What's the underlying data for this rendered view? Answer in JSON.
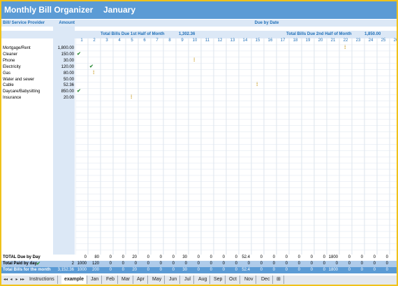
{
  "title": "Monthly Bill Organizer",
  "month": "January",
  "headers": {
    "provider": "Bill/ Service Provider",
    "amount": "Amount",
    "due": "Due by Date"
  },
  "totals": {
    "first_half_label": "Total Bills Due 1st Half of Month",
    "first_half_value": "1,302.36",
    "second_half_label": "Total Bills Due 2nd Half of Month",
    "second_half_value": "1,850.00"
  },
  "days": [
    "1",
    "2",
    "3",
    "4",
    "5",
    "6",
    "7",
    "8",
    "9",
    "10",
    "11",
    "12",
    "13",
    "14",
    "15",
    "16",
    "17",
    "18",
    "19",
    "20",
    "21",
    "22",
    "23",
    "24",
    "25",
    "26"
  ],
  "bills": [
    {
      "name": "Mortgage/Rent",
      "amount": "1,800.00"
    },
    {
      "name": "Cleaner",
      "amount": "150.00"
    },
    {
      "name": "Phone",
      "amount": "30.00"
    },
    {
      "name": "Electricity",
      "amount": "120.00"
    },
    {
      "name": "Gas",
      "amount": "80.00"
    },
    {
      "name": "Water and sewer",
      "amount": "50.00"
    },
    {
      "name": "Cable",
      "amount": "52.36"
    },
    {
      "name": "Daycare/Babysitting",
      "amount": "850.00"
    },
    {
      "name": "Insurance",
      "amount": "20.00"
    }
  ],
  "marks": [
    {
      "row": 0,
      "day": 22,
      "type": "pending"
    },
    {
      "row": 1,
      "day": 1,
      "type": "paid"
    },
    {
      "row": 2,
      "day": 10,
      "type": "pending"
    },
    {
      "row": 3,
      "day": 2,
      "type": "paid"
    },
    {
      "row": 4,
      "day": 2,
      "type": "pending"
    },
    {
      "row": 6,
      "day": 15,
      "type": "pending"
    },
    {
      "row": 7,
      "day": 1,
      "type": "paid"
    },
    {
      "row": 8,
      "day": 5,
      "type": "pending"
    }
  ],
  "footer": {
    "total_due_label": "TOTAL Due by Day",
    "total_paid_label": "Total Paid by day",
    "total_bills_label": "Total Bills for the month",
    "paid_main": "2",
    "bills_main": "3,152.36",
    "due_values": [
      "0",
      "80",
      "0",
      "0",
      "20",
      "0",
      "0",
      "0",
      "30",
      "0",
      "0",
      "0",
      "0",
      "52.4",
      "0",
      "0",
      "0",
      "0",
      "0",
      "0",
      "1800",
      "0",
      "0",
      "0",
      "0",
      "0"
    ],
    "paid_values": [
      "1000",
      "120",
      "0",
      "0",
      "0",
      "0",
      "0",
      "0",
      "0",
      "0",
      "0",
      "0",
      "0",
      "0",
      "0",
      "0",
      "0",
      "0",
      "0",
      "0",
      "0",
      "0",
      "0",
      "0",
      "0",
      "0"
    ],
    "bills_values": [
      "1000",
      "200",
      "0",
      "0",
      "20",
      "0",
      "0",
      "0",
      "30",
      "0",
      "0",
      "0",
      "0",
      "52.4",
      "0",
      "0",
      "0",
      "0",
      "0",
      "0",
      "1800",
      "0",
      "0",
      "0",
      "0",
      "0"
    ]
  },
  "tabs": [
    "Instructions",
    "example",
    "Jan",
    "Feb",
    "Mar",
    "Apr",
    "May",
    "Jun",
    "Jul",
    "Aug",
    "Sep",
    "Oct",
    "Nov",
    "Dec"
  ],
  "active_tab": "example"
}
